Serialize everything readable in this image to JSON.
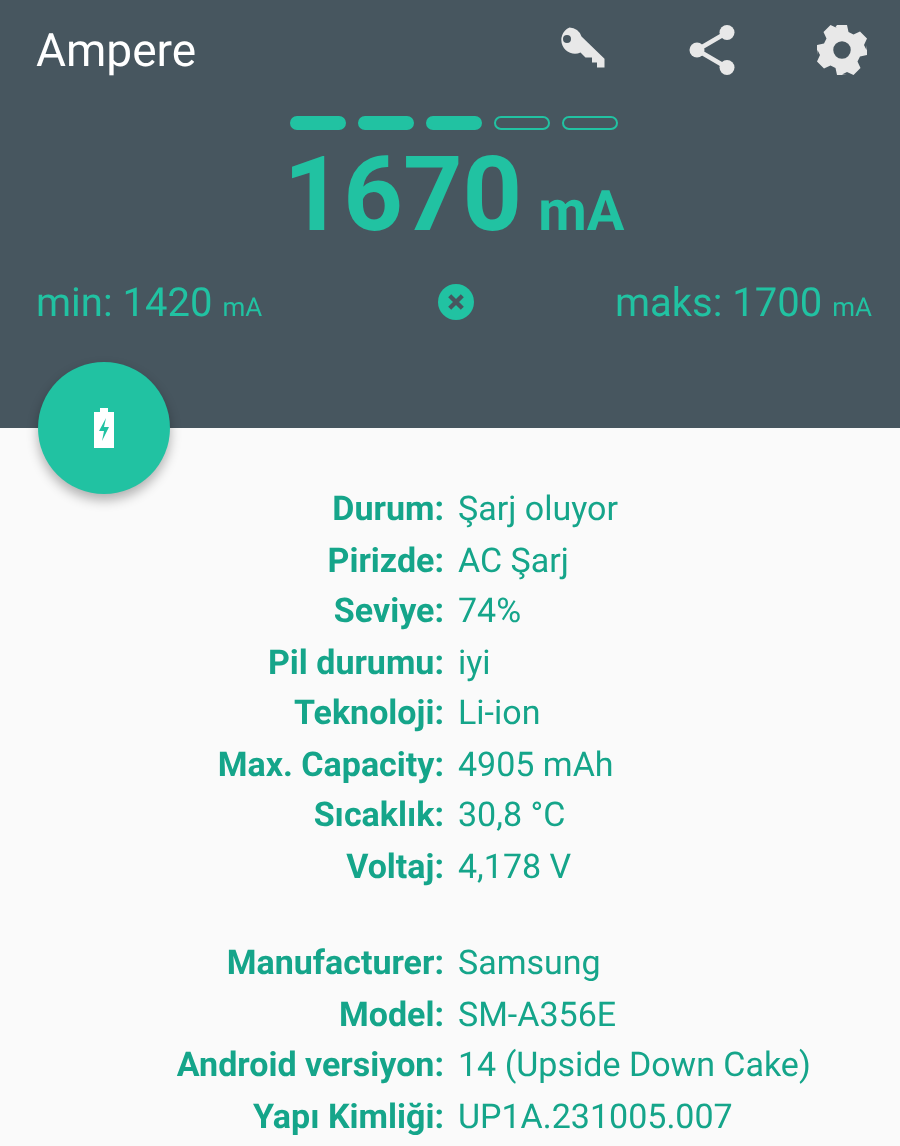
{
  "app_bar": {
    "title": "Ampere"
  },
  "indicator": [
    {
      "filled": true
    },
    {
      "filled": true
    },
    {
      "filled": true
    },
    {
      "filled": false
    },
    {
      "filled": false
    }
  ],
  "current": {
    "value": "1670",
    "unit": "mA"
  },
  "min": {
    "text": "min: 1420",
    "unit": "mA"
  },
  "max": {
    "text": "maks: 1700",
    "unit": "mA"
  },
  "groups": [
    [
      {
        "label": "Durum:",
        "value": "Şarj oluyor"
      },
      {
        "label": "Pirizde:",
        "value": "AC Şarj"
      },
      {
        "label": "Seviye:",
        "value": "74%"
      },
      {
        "label": "Pil durumu:",
        "value": "iyi"
      },
      {
        "label": "Teknoloji:",
        "value": "Li-ion"
      },
      {
        "label": "Max. Capacity:",
        "value": "4905 mAh"
      },
      {
        "label": "Sıcaklık:",
        "value": "30,8 °C"
      },
      {
        "label": "Voltaj:",
        "value": "4,178 V"
      }
    ],
    [
      {
        "label": "Manufacturer:",
        "value": "Samsung"
      },
      {
        "label": "Model:",
        "value": "SM-A356E"
      },
      {
        "label": "Android versiyon:",
        "value": "14 (Upside Down Cake)"
      },
      {
        "label": "Yapı Kimliği:",
        "value": "UP1A.231005.007"
      }
    ]
  ]
}
